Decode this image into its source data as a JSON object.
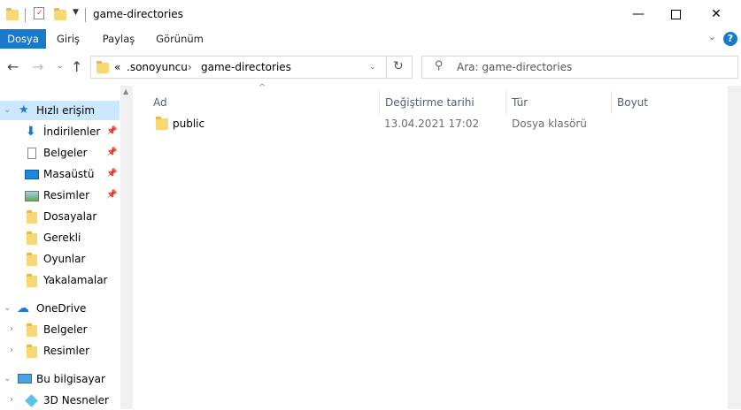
{
  "window": {
    "title": "game-directories"
  },
  "ribbon": {
    "tabs": [
      "Dosya",
      "Giriş",
      "Paylaş",
      "Görünüm"
    ]
  },
  "address": {
    "overflow": "«",
    "crumbs": [
      ".sonoyuncu",
      "game-directories"
    ],
    "search_placeholder": "Ara: game-directories"
  },
  "nav": {
    "quick_access": "Hızlı erişim",
    "items": [
      {
        "label": "İndirilenler",
        "pinned": true
      },
      {
        "label": "Belgeler",
        "pinned": true
      },
      {
        "label": "Masaüstü",
        "pinned": true
      },
      {
        "label": "Resimler",
        "pinned": true
      },
      {
        "label": "Dosayalar"
      },
      {
        "label": "Gerekli"
      },
      {
        "label": "Oyunlar"
      },
      {
        "label": "Yakalamalar"
      }
    ],
    "onedrive": "OneDrive",
    "onedrive_items": [
      "Belgeler",
      "Resimler"
    ],
    "this_pc": "Bu bilgisayar",
    "this_pc_items": [
      "3D Nesneler"
    ]
  },
  "files": {
    "columns": [
      "Ad",
      "Değiştirme tarihi",
      "Tür",
      "Boyut"
    ],
    "rows": [
      {
        "name": "public",
        "date": "13.04.2021 17:02",
        "type": "Dosya klasörü",
        "size": ""
      }
    ]
  },
  "colors": {
    "accent": "#1979ca",
    "selection": "#cce8ff",
    "folder": "#f8d775"
  }
}
